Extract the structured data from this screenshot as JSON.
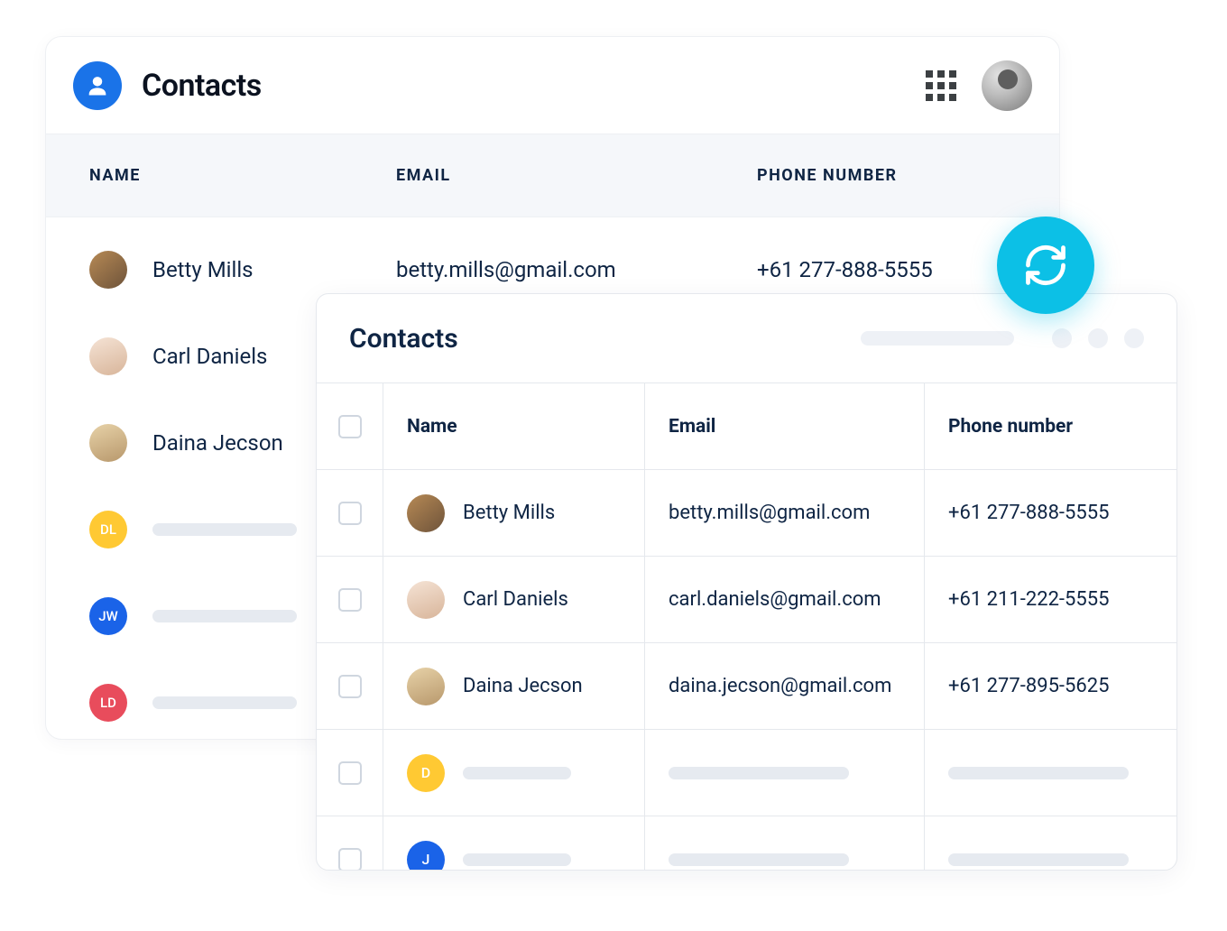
{
  "panelA": {
    "title": "Contacts",
    "columns": {
      "name": "NAME",
      "email": "EMAIL",
      "phone": "PHONE  NUMBER"
    },
    "rows": [
      {
        "name": "Betty Mills",
        "email": "betty.mills@gmail.com",
        "phone": "+61 277-888-5555",
        "avatar": "photo1"
      },
      {
        "name": "Carl Daniels",
        "email": "",
        "phone": "",
        "avatar": "photo2"
      },
      {
        "name": "Daina Jecson",
        "email": "",
        "phone": "",
        "avatar": "photo3"
      },
      {
        "name": "",
        "email": "",
        "phone": "",
        "avatar": "yellow",
        "initials": "DL",
        "placeholder": true
      },
      {
        "name": "",
        "email": "",
        "phone": "",
        "avatar": "blue",
        "initials": "JW",
        "placeholder": true
      },
      {
        "name": "",
        "email": "",
        "phone": "",
        "avatar": "red",
        "initials": "LD",
        "placeholder": true
      }
    ]
  },
  "panelB": {
    "title": "Contacts",
    "columns": {
      "name": "Name",
      "email": "Email",
      "phone": "Phone  number"
    },
    "rows": [
      {
        "name": "Betty Mills",
        "email": "betty.mills@gmail.com",
        "phone": "+61 277-888-5555",
        "avatar": "photo1"
      },
      {
        "name": "Carl Daniels",
        "email": "carl.daniels@gmail.com",
        "phone": "+61 211-222-5555",
        "avatar": "photo2"
      },
      {
        "name": "Daina Jecson",
        "email": "daina.jecson@gmail.com",
        "phone": "+61 277-895-5625",
        "avatar": "photo3"
      },
      {
        "name": "",
        "email": "",
        "phone": "",
        "avatar": "yellow",
        "initials": "D",
        "placeholder": true
      },
      {
        "name": "",
        "email": "",
        "phone": "",
        "avatar": "blue",
        "initials": "J",
        "placeholder": true
      }
    ]
  }
}
